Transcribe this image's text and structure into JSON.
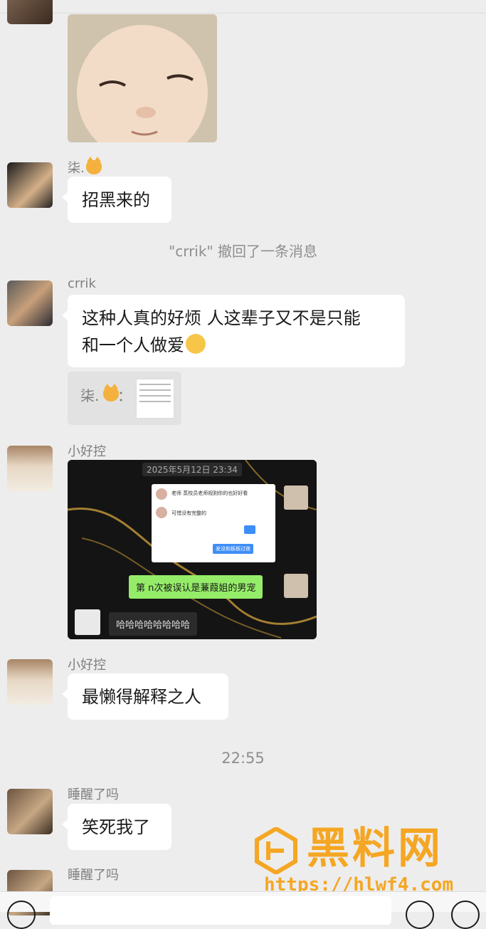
{
  "messages": {
    "m1_nick": "柒.",
    "m1_text": "招黑来的",
    "recall_notice": "\"crrik\" 撤回了一条消息",
    "m2_nick": "crrik",
    "m2_line1": "这种人真的好烦 人这辈子又不是只能",
    "m2_line2": "和一个人做爱",
    "quote_name": "柒.",
    "quote_sep": "：",
    "m3_nick": "小好控",
    "m3_img_timestamp": "2025年5月12日 23:34",
    "m3_img_chat1": "老师 蒸校员老师规则你的也好好看",
    "m3_img_chat2": "可惜没有完整的",
    "m3_img_chat3": "发没和板板过夜",
    "m3_img_green": "第 n次被误认是蒹葭姐的男宠",
    "m3_img_bottom": "哈哈哈哈哈哈哈哈",
    "m4_nick": "小好控",
    "m4_text": "最懒得解释之人",
    "time_divider": "22:55",
    "m5_nick": "睡醒了吗",
    "m5_text": "笑死我了",
    "m6_nick": "睡醒了吗"
  },
  "watermark": {
    "title": "黑料网",
    "url": "https://hlwf4.com"
  },
  "colors": {
    "background": "#ededed",
    "bubble": "#ffffff",
    "wechat_green": "#95ec69",
    "watermark": "#f5a623"
  },
  "icons": [
    "voice-icon",
    "emoji-icon",
    "plus-icon",
    "cat-emoji-icon",
    "sweat-emoji-icon"
  ]
}
